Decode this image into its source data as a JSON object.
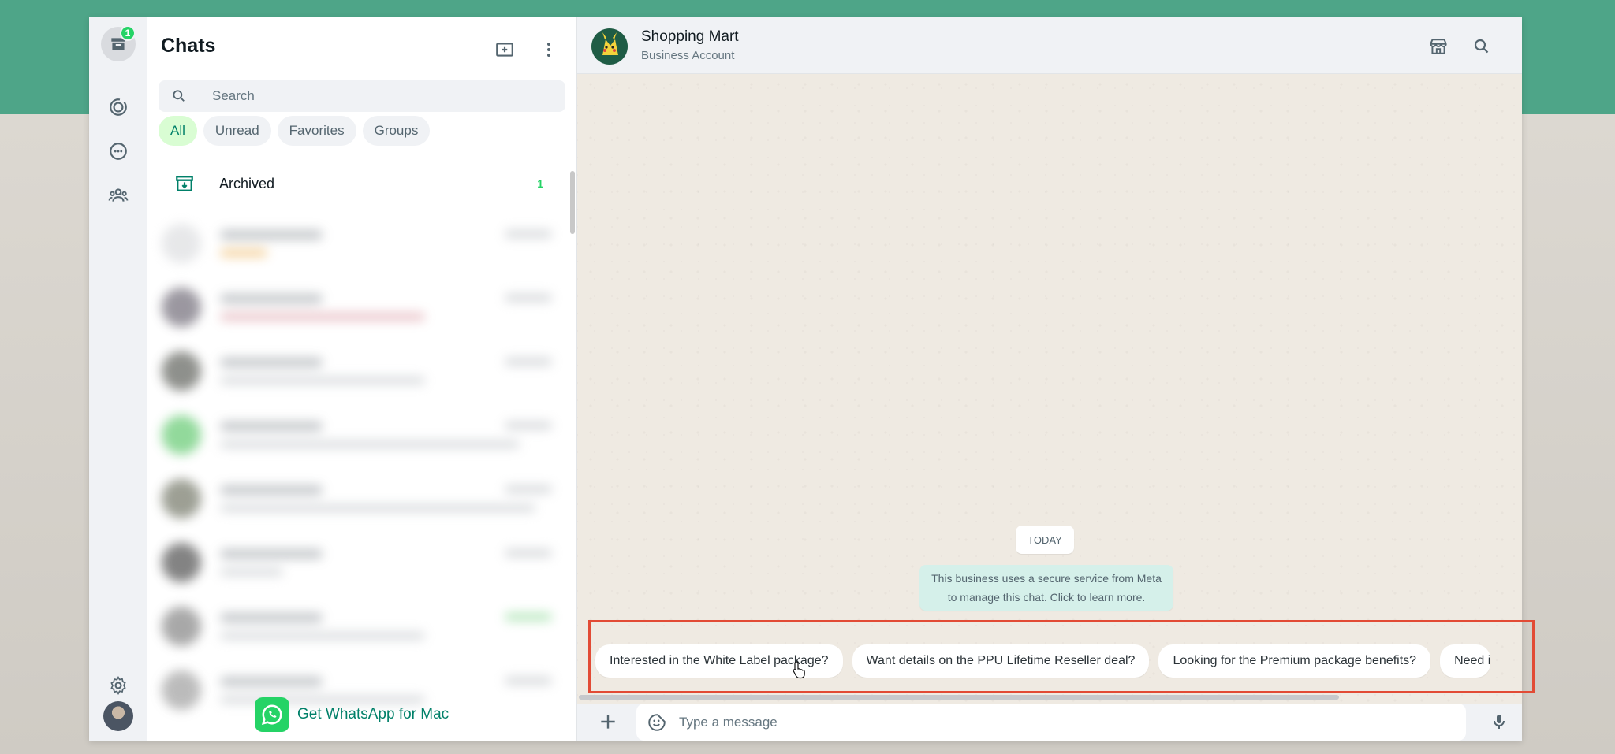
{
  "colors": {
    "accent": "#25d366",
    "brand_green": "#008069",
    "band": "#4ea588",
    "highlight_box": "#e24b35"
  },
  "rail": {
    "archive_badge": "1",
    "icons": [
      "archive-icon",
      "status-icon",
      "channels-icon",
      "communities-icon",
      "settings-icon"
    ]
  },
  "chat_list": {
    "title": "Chats",
    "search_placeholder": "Search",
    "filters": [
      "All",
      "Unread",
      "Favorites",
      "Groups"
    ],
    "active_filter": "All",
    "archived": {
      "label": "Archived",
      "count": "1"
    },
    "get_app": "Get WhatsApp for Mac"
  },
  "conversation": {
    "contact": {
      "name": "Shopping Mart",
      "subtitle": "Business Account"
    },
    "date_divider": "TODAY",
    "system_message": "This business uses a secure service from Meta to manage this chat. Click to learn more.",
    "suggestions": [
      "Interested in the White Label package?",
      "Want details on the PPU Lifetime Reseller deal?",
      "Looking for the Premium package benefits?",
      "Need i"
    ],
    "composer_placeholder": "Type a message"
  }
}
